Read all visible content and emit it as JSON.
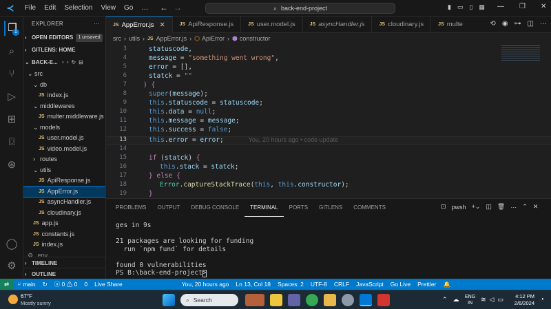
{
  "titlebar": {
    "menu": [
      "File",
      "Edit",
      "Selection",
      "View",
      "Go",
      "…"
    ],
    "search": "back-end-project"
  },
  "activity": {
    "badge": "1"
  },
  "sidebar": {
    "header": "EXPLORER",
    "open_editors": "OPEN EDITORS",
    "unsaved": "1 unsaved",
    "gitlens": "GITLENS: HOME",
    "project": "BACK-E...",
    "tree": [
      {
        "label": "src",
        "type": "folder",
        "depth": 1
      },
      {
        "label": "db",
        "type": "folder",
        "depth": 2
      },
      {
        "label": "index.js",
        "type": "file",
        "depth": 3
      },
      {
        "label": "middlewares",
        "type": "folder",
        "depth": 2
      },
      {
        "label": "multer.middleware.js",
        "type": "file",
        "depth": 3
      },
      {
        "label": "models",
        "type": "folder",
        "depth": 2
      },
      {
        "label": "user.model.js",
        "type": "file",
        "depth": 3
      },
      {
        "label": "video.model.js",
        "type": "file",
        "depth": 3
      },
      {
        "label": "routes",
        "type": "folder",
        "depth": 2
      },
      {
        "label": "utils",
        "type": "folder",
        "depth": 2
      },
      {
        "label": "ApiResponse.js",
        "type": "file",
        "depth": 3
      },
      {
        "label": "AppError.js",
        "type": "file",
        "depth": 3
      },
      {
        "label": "asyncHandler.js",
        "type": "file",
        "depth": 3
      },
      {
        "label": "cloudinary.js",
        "type": "file",
        "depth": 3
      },
      {
        "label": "app.js",
        "type": "file",
        "depth": 2
      },
      {
        "label": "constants.js",
        "type": "file",
        "depth": 2
      },
      {
        "label": "index.js",
        "type": "file",
        "depth": 2
      },
      {
        "label": ".env",
        "type": "env",
        "depth": 1
      }
    ],
    "timeline": "TIMELINE",
    "outline": "OUTLINE"
  },
  "tabs": [
    "AppError.js",
    "ApiResponse.js",
    "user.model.js",
    "asyncHandler.js",
    "cloudinary.js",
    "multe"
  ],
  "breadcrumb": [
    "src",
    "utils",
    "AppError.js",
    "ApiError",
    "constructor"
  ],
  "editor": {
    "line_numbers": [
      "3",
      "4",
      "5",
      "6",
      "7",
      "8",
      "9",
      "10",
      "11",
      "12",
      "13",
      "14",
      "15",
      "16",
      "17",
      "18",
      "19"
    ],
    "blame": "You, 20 hours ago • code update"
  },
  "panel": {
    "tabs": [
      "PROBLEMS",
      "OUTPUT",
      "DEBUG CONSOLE",
      "TERMINAL",
      "PORTS",
      "GITLENS",
      "COMMENTS"
    ],
    "shell": "pwsh",
    "terminal": [
      "ges in 9s",
      "",
      "21 packages are looking for funding",
      "  run `npm fund` for details",
      "",
      "found 0 vulnerabilities",
      "PS B:\\back-end-project> "
    ]
  },
  "status": {
    "branch": "main",
    "problems": "ⓧ 0 ⚠ 0",
    "ports": "0",
    "live_share": "Live Share",
    "blame": "You, 20 hours ago",
    "position": "Ln 13, Col 18",
    "spaces": "Spaces: 2",
    "encoding": "UTF-8",
    "eol": "CRLF",
    "language": "JavaScript",
    "go_live": "Go Live",
    "prettier": "Prettier"
  },
  "taskbar": {
    "weather_temp": "67°F",
    "weather_desc": "Mostly sunny",
    "search": "Search",
    "lang": "ENG",
    "region": "IN",
    "time": "4:12 PM",
    "date": "2/6/2024"
  },
  "colors": {
    "accent": "#007acc",
    "keyword": "#569cd6",
    "string": "#ce9178",
    "variable": "#9cdcfe"
  }
}
